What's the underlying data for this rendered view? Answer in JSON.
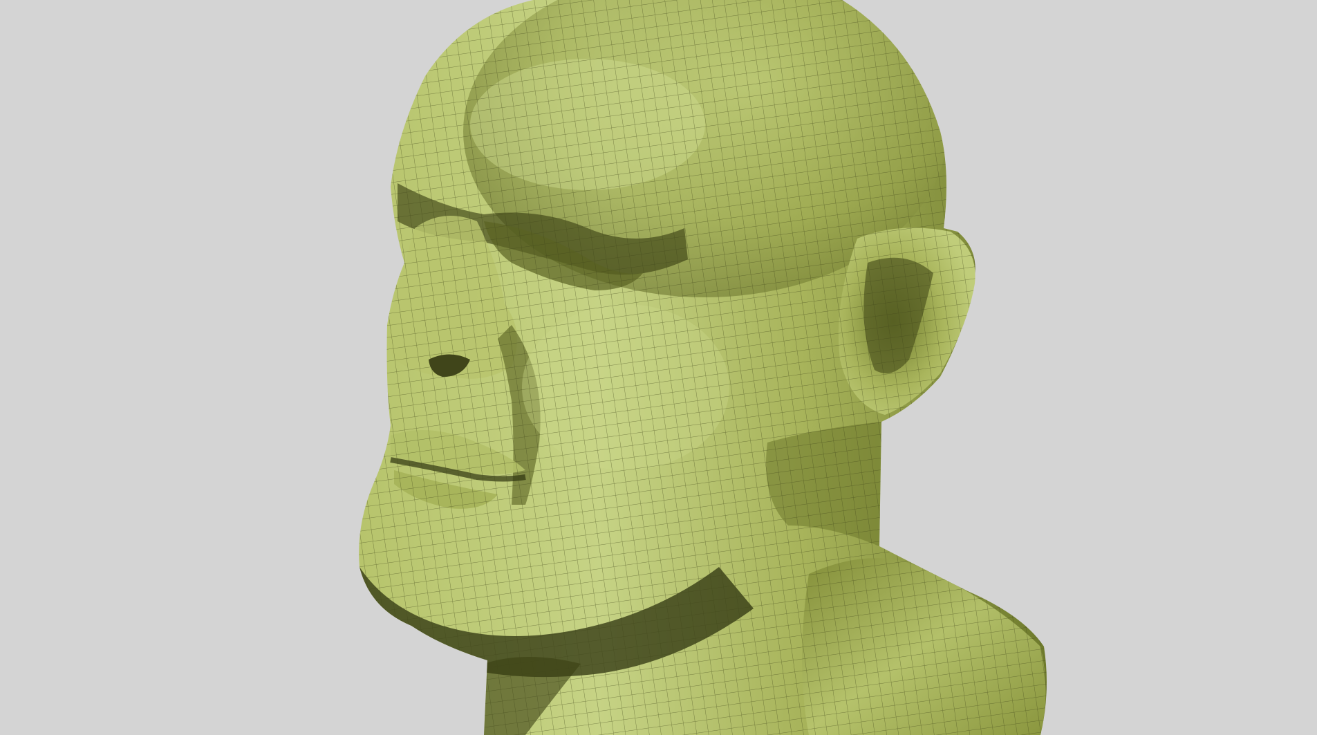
{
  "viewport": {
    "background_color": "#d4d4d4",
    "model_color_light": "#c9d68a",
    "model_color_mid": "#9aa64e",
    "model_color_dark": "#454a18",
    "wire_color": "#3f4519"
  }
}
